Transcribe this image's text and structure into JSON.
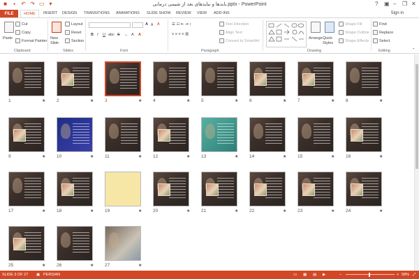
{
  "window": {
    "title": "بایدها و نبایدهای بعد از شیمی درمانی.pptx - PowerPoint",
    "signin": "Sign in",
    "help": "?",
    "minimize": "–",
    "restore": "❐",
    "close": "✕"
  },
  "tabs": [
    "FILE",
    "HOME",
    "INSERT",
    "DESIGN",
    "TRANSITIONS",
    "ANIMATIONS",
    "SLIDE SHOW",
    "REVIEW",
    "VIEW",
    "ADD-INS"
  ],
  "ribbon": {
    "clipboard": {
      "paste": "Paste",
      "cut": "Cut",
      "copy": "Copy",
      "format_painter": "Format Painter",
      "label": "Clipboard"
    },
    "slides": {
      "new_slide": "New Slide",
      "layout": "Layout",
      "reset": "Reset",
      "section": "Section",
      "label": "Slides"
    },
    "font": {
      "label": "Font",
      "bold": "B",
      "italic": "I",
      "underline": "U",
      "strike": "S",
      "shadow": "abc",
      "aa": "A",
      "size_up": "A",
      "size_down": "A",
      "clear": "A"
    },
    "paragraph": {
      "text_direction": "Text Direction",
      "align_text": "Align Text",
      "convert_smartart": "Convert to SmartArt",
      "label": "Paragraph"
    },
    "drawing": {
      "arrange": "Arrange",
      "quick_styles": "Quick Styles",
      "shape_fill": "Shape Fill",
      "shape_outline": "Shape Outline",
      "shape_effects": "Shape Effects",
      "label": "Drawing"
    },
    "editing": {
      "find": "Find",
      "replace": "Replace",
      "select": "Select",
      "label": "Editing"
    }
  },
  "slides": [
    {
      "n": "1"
    },
    {
      "n": "2"
    },
    {
      "n": "3",
      "selected": true
    },
    {
      "n": "4"
    },
    {
      "n": "5"
    },
    {
      "n": "6"
    },
    {
      "n": "7"
    },
    {
      "n": "8"
    },
    {
      "n": "9"
    },
    {
      "n": "10",
      "style": "blue"
    },
    {
      "n": "11"
    },
    {
      "n": "12"
    },
    {
      "n": "13",
      "style": "teal"
    },
    {
      "n": "14"
    },
    {
      "n": "15"
    },
    {
      "n": "16"
    },
    {
      "n": "17"
    },
    {
      "n": "18"
    },
    {
      "n": "19",
      "style": "yellow"
    },
    {
      "n": "20"
    },
    {
      "n": "21"
    },
    {
      "n": "22"
    },
    {
      "n": "23"
    },
    {
      "n": "24"
    },
    {
      "n": "25"
    },
    {
      "n": "26"
    },
    {
      "n": "27",
      "style": "photo"
    }
  ],
  "star_glyph": "★",
  "status": {
    "slide_info": "SLIDE 3 OF 27",
    "language": "PERSIAN",
    "zoom": "58%",
    "minus": "–",
    "plus": "+",
    "fit": "⤢"
  },
  "colors": {
    "accent": "#d24726",
    "selected_border": "#d24726"
  }
}
